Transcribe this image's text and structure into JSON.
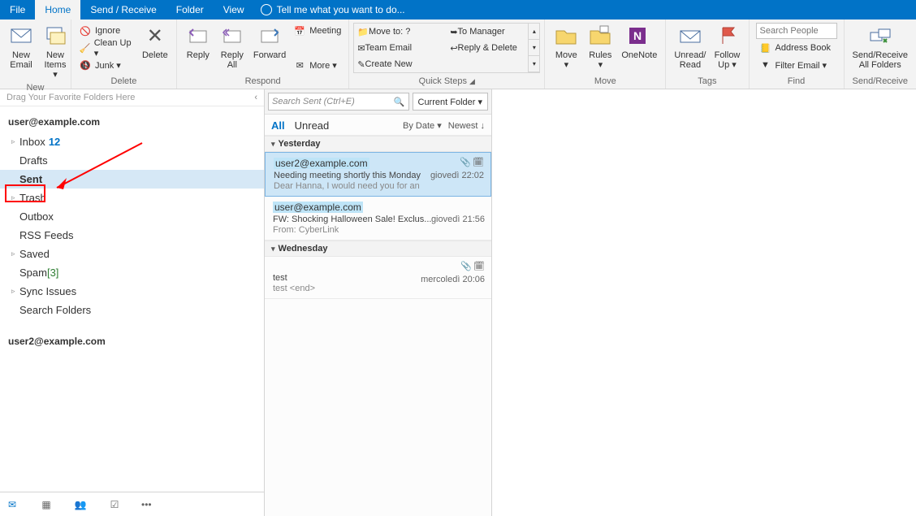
{
  "menubar": {
    "tabs": [
      "File",
      "Home",
      "Send / Receive",
      "Folder",
      "View"
    ],
    "active": "Home",
    "tell_me": "Tell me what you want to do..."
  },
  "ribbon": {
    "new": {
      "email": "New\nEmail",
      "items": "New\nItems ▾",
      "label": "New"
    },
    "delete": {
      "ignore": "Ignore",
      "cleanup": "Clean Up ▾",
      "junk": "Junk ▾",
      "delete": "Delete",
      "label": "Delete"
    },
    "respond": {
      "reply": "Reply",
      "replyall": "Reply\nAll",
      "forward": "Forward",
      "meeting": "Meeting",
      "more": "More ▾",
      "label": "Respond"
    },
    "quicksteps": {
      "items": [
        "Move to: ?",
        "To Manager",
        "Team Email",
        "Reply & Delete",
        "Create New"
      ],
      "label": "Quick Steps"
    },
    "move": {
      "move": "Move\n▾",
      "rules": "Rules\n▾",
      "onenote": "OneNote",
      "label": "Move"
    },
    "tags": {
      "unread": "Unread/\nRead",
      "follow": "Follow\nUp ▾",
      "label": "Tags"
    },
    "find": {
      "search_ph": "Search People",
      "address": "Address Book",
      "filter": "Filter Email ▾",
      "label": "Find"
    },
    "sendrec": {
      "btn": "Send/Receive\nAll Folders",
      "label": "Send/Receive"
    }
  },
  "folder_pane": {
    "fav_hint": "Drag Your Favorite Folders Here",
    "account1": "user@example.com",
    "folders": [
      {
        "name": "Inbox",
        "count": "12",
        "expander": "▹"
      },
      {
        "name": "Drafts"
      },
      {
        "name": "Sent",
        "selected": true
      },
      {
        "name": "Trash",
        "expander": "▹"
      },
      {
        "name": "Outbox"
      },
      {
        "name": "RSS Feeds"
      },
      {
        "name": "Saved",
        "expander": "▹"
      },
      {
        "name": "Spam",
        "bracket": "[3]"
      },
      {
        "name": "Sync Issues",
        "expander": "▹"
      },
      {
        "name": "Search Folders"
      }
    ],
    "account2": "user2@example.com"
  },
  "msg_pane": {
    "search_ph": "Search Sent (Ctrl+E)",
    "scope": "Current Folder ▾",
    "tabs": {
      "all": "All",
      "unread": "Unread"
    },
    "sort_by": "By Date ▾",
    "sort_order": "Newest ↓",
    "groups": [
      {
        "header": "Yesterday",
        "items": [
          {
            "from": "user2@example.com",
            "subject": "Needing meeting shortly this Monday",
            "preview": "Dear Hanna,  I would need you for an",
            "date": "giovedì 22:02",
            "attach": true,
            "cal": true,
            "selected": true
          },
          {
            "from": "user@example.com",
            "subject": "FW: Shocking Halloween Sale! Exclus...",
            "preview": "From: CyberLink",
            "date": "giovedì 21:56"
          }
        ]
      },
      {
        "header": "Wednesday",
        "items": [
          {
            "from": "",
            "subject": "test",
            "preview": "test <end>",
            "date": "mercoledì 20:06",
            "attach": true,
            "cal": true
          }
        ]
      }
    ]
  }
}
